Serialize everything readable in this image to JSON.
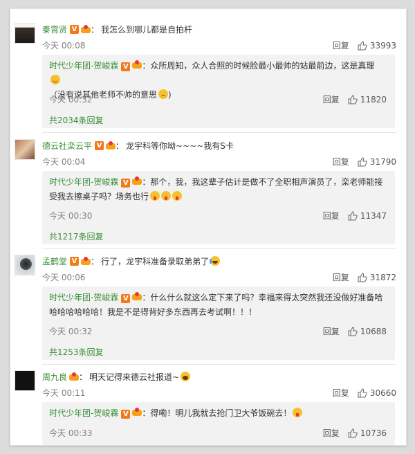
{
  "colors": {
    "name_green": "#3a8f3a",
    "badge_orange": "#f37a1a",
    "reply_bg": "#f2f2f2",
    "meta_gray": "#808080"
  },
  "labels": {
    "reply": "回复",
    "colon": "：",
    "v": "V"
  },
  "comments": [
    {
      "name": "秦霄贤",
      "text": "我怎么到哪儿都是自拍杆",
      "time": "今天 00:08",
      "likes": "33993",
      "reply": {
        "name": "时代少年团-贺峻霖",
        "text": "众所周知，众人合照的时候脸最小最帅的站最前边，这是真理",
        "text2": "（没有说其他老师不帅的意思",
        "time": "今天 00:32",
        "likes": "11820"
      },
      "more": "共2034条回复"
    },
    {
      "name": "德云社栾云平",
      "text": "龙宇科等你呦~~~~我有S卡",
      "time": "今天 00:04",
      "likes": "31790",
      "reply": {
        "name": "时代少年团-贺峻霖",
        "text": "那个，我，我这辈子估计是做不了全职相声演员了，栾老师能接",
        "text2": "受我去擦桌子吗？场务也行",
        "time": "今天 00:30",
        "likes": "11347"
      },
      "more": "共1217条回复"
    },
    {
      "name": "孟鹤堂",
      "text": "行了，龙宇科准备录取弟弟了",
      "time": "今天 00:06",
      "likes": "31872",
      "reply": {
        "name": "时代少年团-贺峻霖",
        "text": "什么什么就这么定下来了吗？幸福来得太突然我还没做好准备哈",
        "text2": "哈哈哈哈哈哈！我是不是得背好多东西再去考试啊！！！",
        "time": "今天 00:32",
        "likes": "10688"
      },
      "more": "共1253条回复"
    },
    {
      "name": "周九良",
      "text": "明天记得来德云社报道~",
      "time": "今天 00:11",
      "likes": "30660",
      "reply": {
        "name": "时代少年团-贺峻霖",
        "text": "得嘞！明儿我就去抢门卫大爷饭碗去！",
        "time": "今天 00:33",
        "likes": "10736"
      }
    }
  ]
}
